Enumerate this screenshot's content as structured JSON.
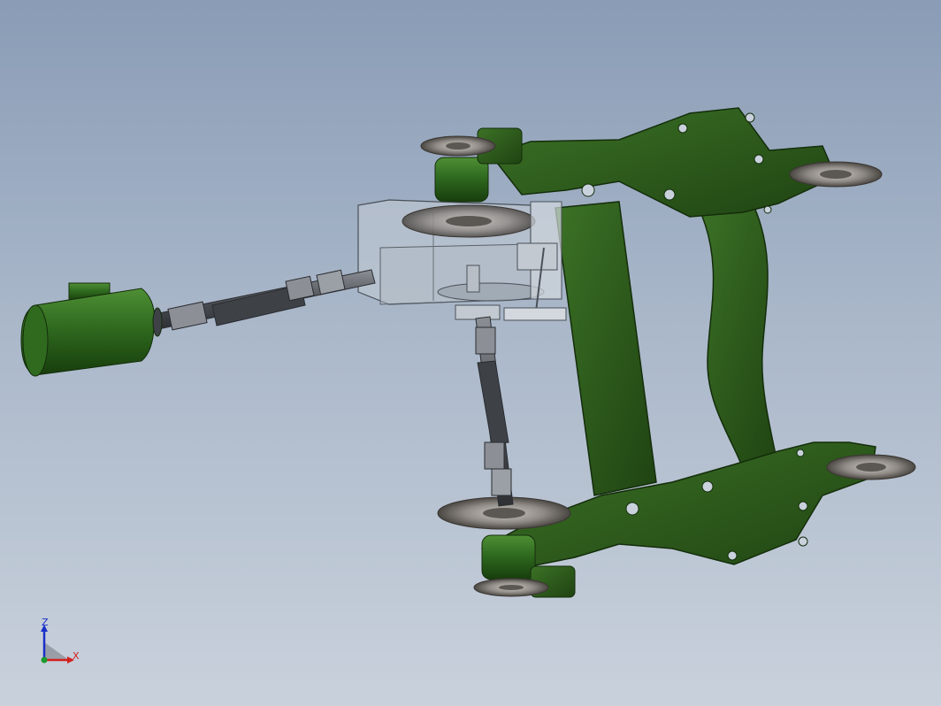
{
  "viewport": {
    "background_top": "#8a9cb6",
    "background_bottom": "#c9d1dc"
  },
  "model": {
    "frame_color": "#2e5a1c",
    "frame_dark": "#1e3d12",
    "motor_color": "#2f6a1f",
    "shaft_color": "#55585c",
    "wheel_color": "#8f8a85",
    "housing_color": "#b9c2cc"
  },
  "triad": {
    "z_label": "Z",
    "x_label": "X",
    "z_color": "#1a2fc8",
    "x_color": "#d32020",
    "y_color": "#1a9a2a"
  }
}
